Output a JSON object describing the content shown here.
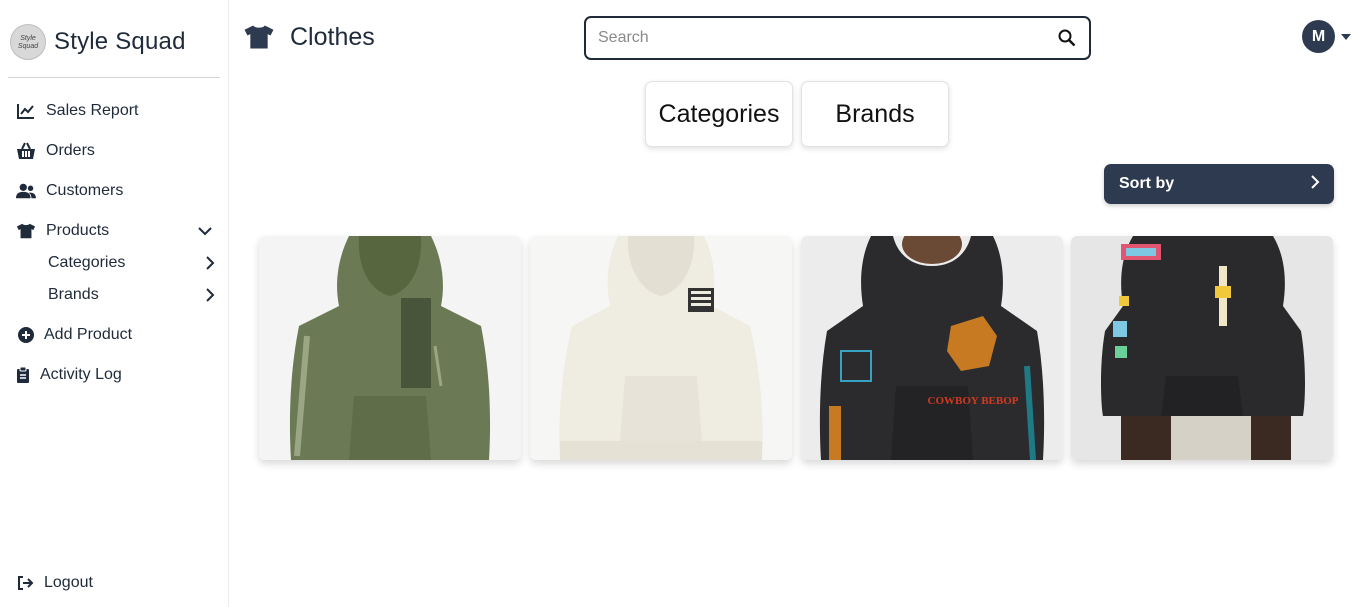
{
  "sidebar": {
    "brand": {
      "name": "Style Squad",
      "logo_text": "Style Squad"
    },
    "items": [
      {
        "label": "Sales Report",
        "icon": "chart-line-icon"
      },
      {
        "label": "Orders",
        "icon": "basket-icon"
      },
      {
        "label": "Customers",
        "icon": "users-icon"
      },
      {
        "label": "Products",
        "icon": "shirt-icon",
        "expanded": true
      },
      {
        "label": "Add Product",
        "icon": "plus-circle-icon"
      },
      {
        "label": "Activity Log",
        "icon": "clipboard-icon"
      }
    ],
    "sub_items": [
      {
        "label": "Categories"
      },
      {
        "label": "Brands"
      }
    ],
    "logout": {
      "label": "Logout",
      "icon": "logout-icon"
    }
  },
  "header": {
    "title": "Clothes",
    "icon": "shirt-icon",
    "search": {
      "placeholder": "Search",
      "value": ""
    },
    "user": {
      "initial": "M"
    }
  },
  "filters": {
    "categories_label": "Categories",
    "brands_label": "Brands",
    "sort_label": "Sort by"
  },
  "products": [
    {
      "image": "olive green graphic hoodie",
      "color": "#6b7a55"
    },
    {
      "image": "cream white graphic hoodie",
      "color": "#f1efe7"
    },
    {
      "image": "black Cowboy Bebop hoodie",
      "color": "#2b2b2d"
    },
    {
      "image": "black graphic print hoodie",
      "color": "#2a2a2c"
    }
  ],
  "product_print_text": {
    "bebop_print": "COWBOY BEBOP"
  },
  "colors": {
    "primary": "#2d3a4f",
    "text": "#1f2a3a"
  }
}
